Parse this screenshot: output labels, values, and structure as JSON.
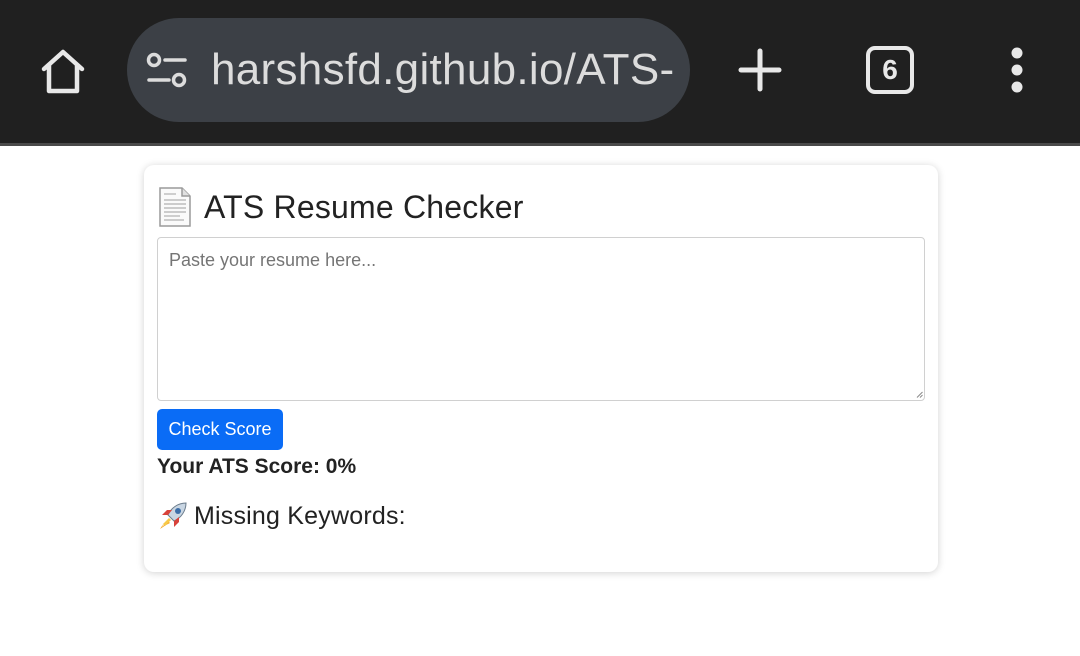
{
  "browser": {
    "url_display": "harshsfd.github.io/ATS-",
    "tab_count": "6",
    "icons": {
      "home": "home-icon",
      "site_settings": "tune-icon",
      "new_tab": "plus-icon",
      "menu": "more-vert-icon"
    },
    "colors": {
      "toolbar_bg": "#202020",
      "urlbar_bg": "#3c4046"
    }
  },
  "app": {
    "title": "ATS Resume Checker",
    "title_icon": "document-icon",
    "resume_input": {
      "placeholder": "Paste your resume here...",
      "value": ""
    },
    "check_button_label": "Check Score",
    "score_text": "Your ATS Score: 0%",
    "missing_icon": "rocket-icon",
    "missing_heading": "Missing Keywords:",
    "colors": {
      "button_bg": "#0a6cf6",
      "button_text": "#ffffff"
    }
  }
}
